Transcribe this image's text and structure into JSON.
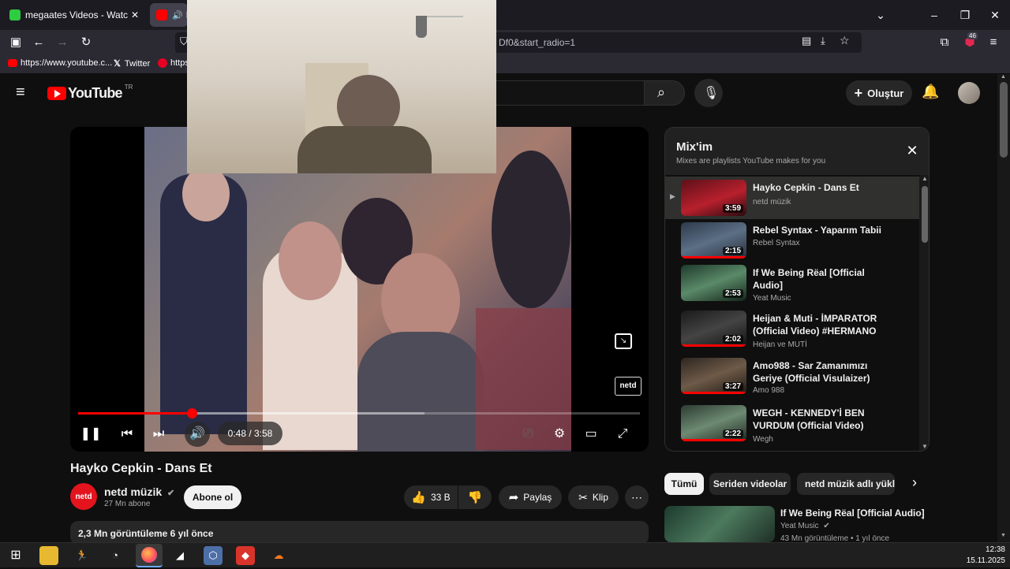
{
  "browser": {
    "tabs": [
      {
        "label": "megaates Videos - Watch On-D",
        "active": false
      },
      {
        "label": "H",
        "active": true
      }
    ],
    "url_fragment": "Df0&start_radio=1",
    "bookmarks": [
      {
        "label": "https://www.youtube.c..."
      },
      {
        "label": "Twitter"
      },
      {
        "label": "https"
      }
    ],
    "extension_badge": "46"
  },
  "youtube": {
    "logo_text": "YouTube",
    "region": "TR",
    "create_label": "Oluştur"
  },
  "player": {
    "time_label": "0:48 / 3:58",
    "progress_fraction": 0.2017,
    "buffer_fraction": 0.617,
    "watermark": "netd"
  },
  "video": {
    "title": "Hayko Cepkin - Dans Et",
    "channel": "netd müzik",
    "subscribers": "27 Mn abone",
    "subscribe_label": "Abone ol",
    "likes": "33 B",
    "share_label": "Paylaş",
    "clip_label": "Klip",
    "description_meta": "2,3 Mn görüntüleme  6 yıl önce"
  },
  "mix": {
    "title": "Mix'im",
    "subtitle": "Mixes are playlists YouTube makes for you",
    "items": [
      {
        "title": "Hayko Cepkin - Dans Et",
        "channel": "netd müzik",
        "duration": "3:59",
        "active": true
      },
      {
        "title": "Rebel Syntax - Yaparım Tabii",
        "channel": "Rebel Syntax",
        "duration": "2:15",
        "active": false
      },
      {
        "title": "If We Being Rëal [Official Audio]",
        "channel": "Yeat Music",
        "duration": "2:53",
        "active": false
      },
      {
        "title": "Heijan & Muti - İMPARATOR (Official Video) #HERMANO",
        "channel": "Heijan ve MUTİ",
        "duration": "2:02",
        "active": false
      },
      {
        "title": "Amo988 - Sar Zamanımızı Geriye (Official Visulaizer)",
        "channel": "Amo 988",
        "duration": "3:27",
        "active": false
      },
      {
        "title": "WEGH - KENNEDY'İ BEN VURDUM (Official Video)",
        "channel": "Wegh",
        "duration": "2:22",
        "active": false
      }
    ]
  },
  "chips": [
    "Tümü",
    "Seriden videolar",
    "netd müzik adlı yükle"
  ],
  "recommended": {
    "title": "If We Being Rëal [Official Audio]",
    "channel": "Yeat Music",
    "meta": "43 Mn görüntüleme • 1 yıl önce"
  },
  "taskbar": {
    "time": "12:38",
    "date": "15.11.2025"
  }
}
